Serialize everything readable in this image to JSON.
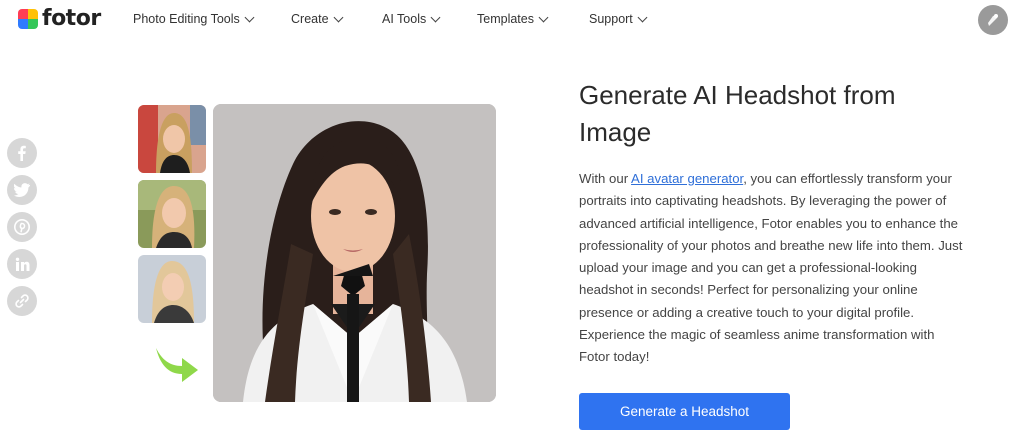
{
  "brand": {
    "name": "fotor"
  },
  "nav": {
    "items": [
      {
        "label": "Photo Editing Tools"
      },
      {
        "label": "Create"
      },
      {
        "label": "AI Tools"
      },
      {
        "label": "Templates"
      },
      {
        "label": "Support"
      }
    ]
  },
  "share": [
    "facebook-icon",
    "twitter-icon",
    "pinterest-icon",
    "linkedin-icon",
    "link-icon"
  ],
  "hero": {
    "title": "Generate AI Headshot from Image",
    "desc_before": "With our ",
    "desc_link": "AI avatar generator",
    "desc_after": ", you can effortlessly transform your portraits into captivating headshots. By leveraging the power of advanced artificial intelligence, Fotor enables you to enhance the professionality of your photos and breathe new life into them. Just upload your image and you can get a professional-looking headshot in seconds! Perfect for personalizing your online presence or adding a creative touch to your digital profile. Experience the magic of seamless anime transformation with Fotor today!",
    "cta_label": "Generate a Headshot"
  },
  "colors": {
    "accent": "#2f73f0",
    "link": "#2f6fd8",
    "arrow": "#8fd84a"
  }
}
